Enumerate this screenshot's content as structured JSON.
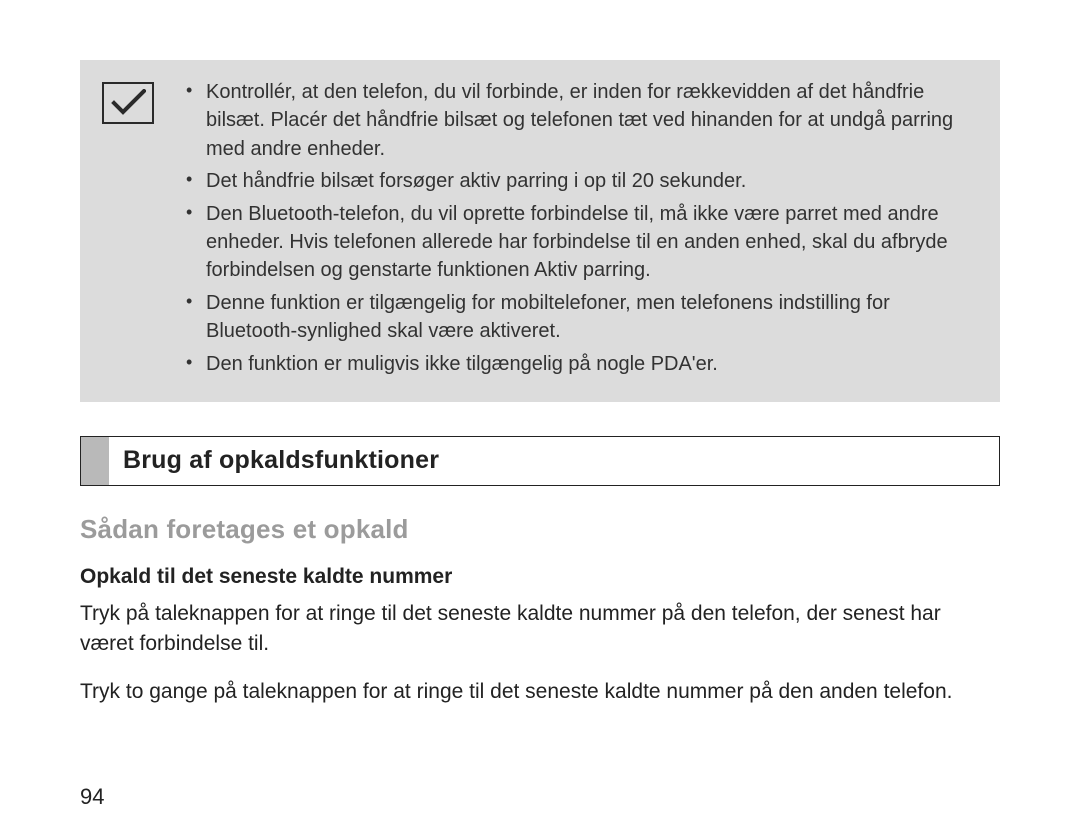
{
  "notebox": {
    "items": [
      "Kontrollér, at den telefon, du vil forbinde, er inden for rækkevidden af det håndfrie bilsæt. Placér det håndfrie bilsæt og telefonen tæt ved hinanden for at undgå parring med andre enheder.",
      "Det håndfrie bilsæt forsøger aktiv parring i op til 20 sekunder.",
      "Den Bluetooth-telefon, du vil oprette forbindelse til, må ikke være parret med andre enheder. Hvis telefonen allerede har forbindelse til en anden enhed, skal du afbryde forbindelsen og genstarte funktionen Aktiv parring.",
      "Denne funktion er tilgængelig for mobiltelefoner, men telefonens indstilling for Bluetooth-synlighed skal være aktiveret.",
      "Den funktion er muligvis ikke tilgængelig på nogle PDA'er."
    ]
  },
  "section_heading": "Brug af opkaldsfunktioner",
  "sub_heading": "Sådan foretages et opkald",
  "sub_sub_heading": "Opkald til det seneste kaldte nummer",
  "paragraphs": [
    "Tryk på taleknappen for at ringe til det seneste kaldte nummer på den telefon, der senest har været forbindelse til.",
    "Tryk to gange på taleknappen for at ringe til det seneste kaldte nummer på den anden telefon."
  ],
  "page_number": "94"
}
